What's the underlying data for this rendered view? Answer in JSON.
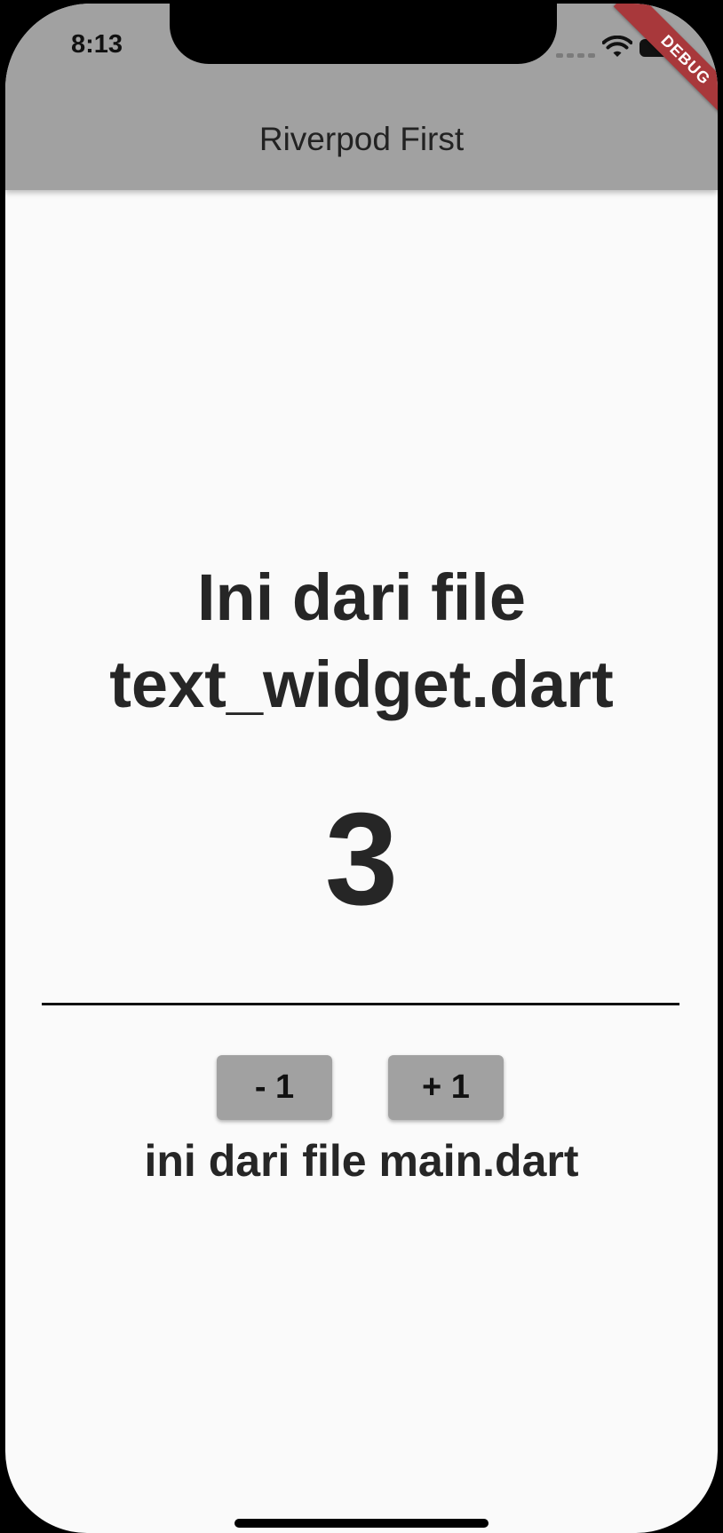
{
  "status_bar": {
    "time": "8:13",
    "icons": [
      "cellular-signal-icon",
      "wifi-icon",
      "battery-icon"
    ]
  },
  "debug_banner": "DEBUG",
  "app_bar": {
    "title": "Riverpod First"
  },
  "main": {
    "heading_line1": "Ini dari file",
    "heading_line2": "text_widget.dart",
    "counter_value": "3",
    "decrement_label": "- 1",
    "increment_label": "+ 1",
    "footer_text": "ini dari file main.dart"
  },
  "colors": {
    "app_bar": "#a1a1a1",
    "background": "#fafafa",
    "button": "#a1a1a1",
    "text": "#262626",
    "debug_banner": "#a8383b"
  }
}
